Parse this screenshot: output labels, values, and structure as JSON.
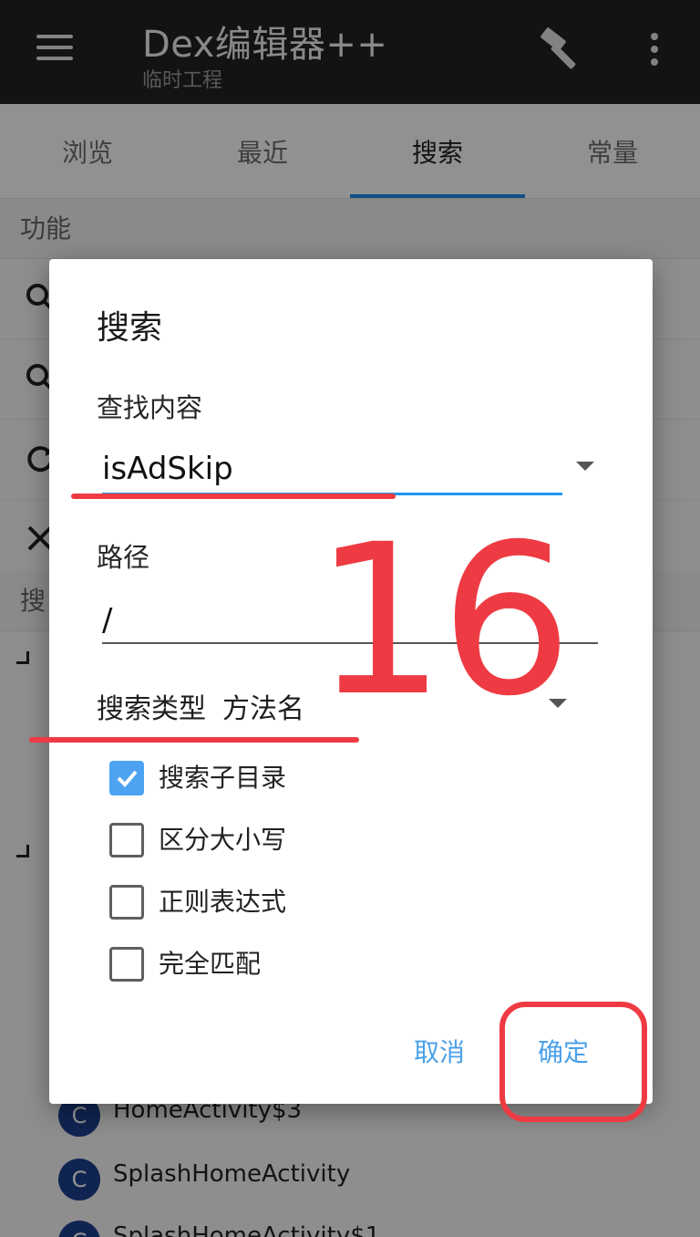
{
  "app": {
    "title": "Dex编辑器++",
    "subtitle": "临时工程"
  },
  "tabs": [
    {
      "label": "浏览"
    },
    {
      "label": "最近"
    },
    {
      "label": "搜索"
    },
    {
      "label": "常量"
    }
  ],
  "background": {
    "section1_title": "功能",
    "section2_title_partial": "搜",
    "list_items": [
      {
        "badge": "C",
        "label": "HomeActivity$3"
      },
      {
        "badge": "C",
        "label": "SplashHomeActivity"
      },
      {
        "badge": "C",
        "label": "SplashHomeActivity$1"
      }
    ]
  },
  "dialog": {
    "title": "搜索",
    "content_label": "查找内容",
    "content_value": "isAdSkip",
    "path_label": "路径",
    "path_value": "/",
    "type_label": "搜索类型",
    "type_value": "方法名",
    "options": [
      {
        "label": "搜索子目录",
        "checked": true
      },
      {
        "label": "区分大小写",
        "checked": false
      },
      {
        "label": "正则表达式",
        "checked": false
      },
      {
        "label": "完全匹配",
        "checked": false
      }
    ],
    "cancel_label": "取消",
    "ok_label": "确定"
  },
  "annotation": {
    "step_number": "16",
    "color": "#ee3b43"
  },
  "colors": {
    "appbar": "#212121",
    "accent": "#1e88e5",
    "checkbox_checked": "#4da3f2",
    "dialog_button": "#4aa0e8"
  }
}
